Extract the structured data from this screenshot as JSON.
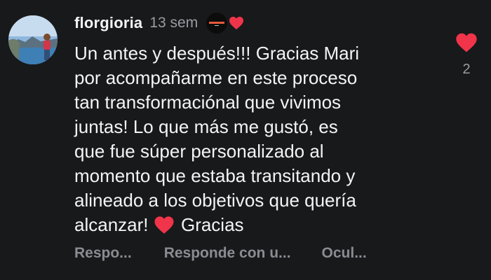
{
  "comment": {
    "username": "florgioria",
    "timestamp": "13 sem",
    "text_lines": [
      "Un antes y después!!! Gracias Mari",
      "por acompañarme en este proceso",
      "tan transformaciónal que vivimos",
      "juntas! Lo que más me gustó, es",
      "que fue súper personalizado al",
      "momento que estaba transitando y",
      "alineado a los objetivos que quería"
    ],
    "text_last": "alcanzar!",
    "text_end": "Gracias",
    "like_count": "2",
    "liked": true
  },
  "actions": {
    "reply": "Respo...",
    "reply_with": "Responde con u...",
    "hide": "Ocul..."
  },
  "icons": {
    "avatar": "profile-photo",
    "creator_like": "creator-liked-heart",
    "like": "heart-icon-filled",
    "inline_emoji": "red-heart-emoji"
  },
  "colors": {
    "background": "#18191b",
    "text": "#f4f4f5",
    "muted": "#8a8c91",
    "heart": "#f0344a"
  }
}
